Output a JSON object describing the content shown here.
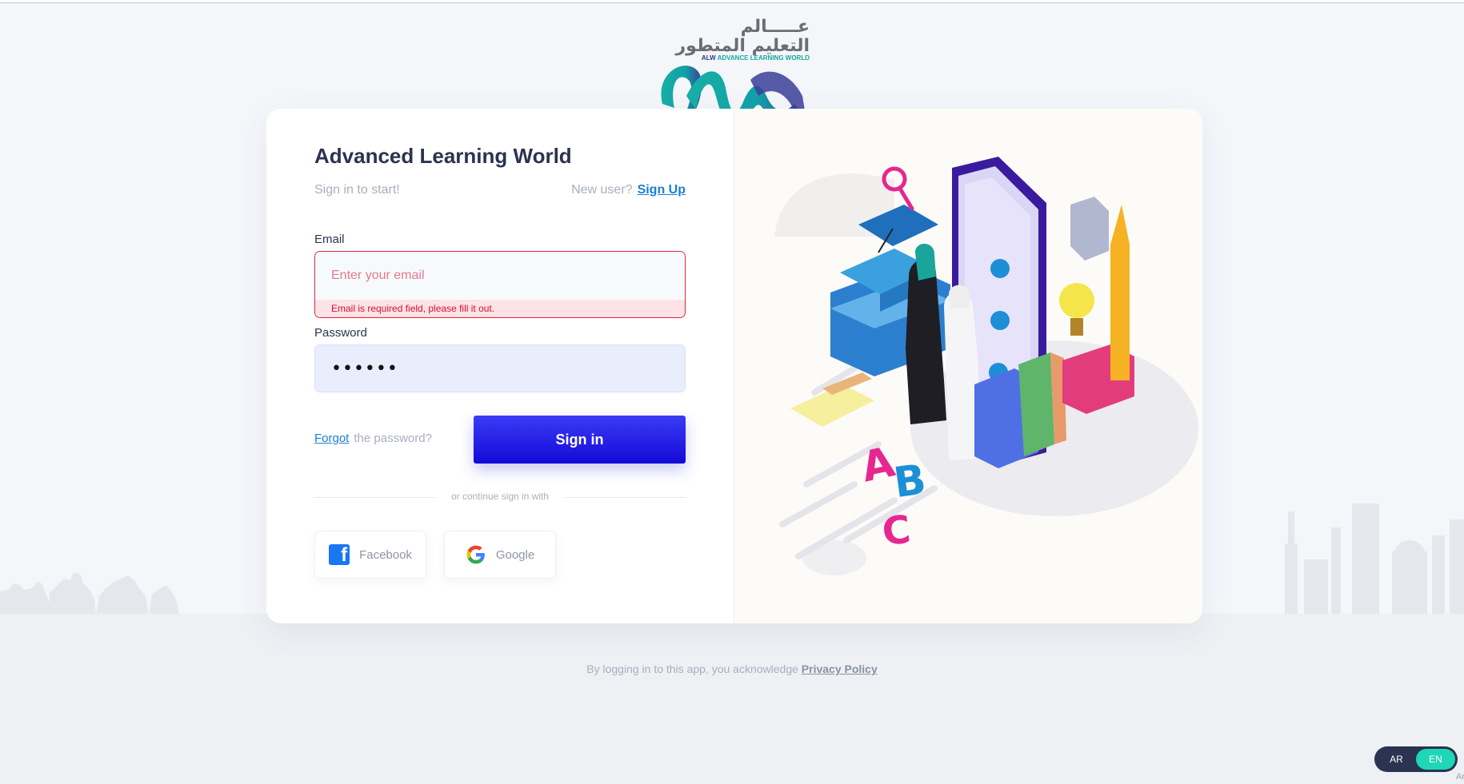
{
  "app": {
    "title": "Advanced Learning World",
    "logo": {
      "arabic_line1": "عـــــالم",
      "arabic_line2": "التعليم المتطور",
      "english_prefix": "ALW",
      "english_name": "ADVANCE LEARNING WORLD",
      "colors": {
        "teal": "#14a8a0",
        "navy": "#2d3a88"
      }
    }
  },
  "login": {
    "subtitle": "Sign in to start!",
    "new_user_text": "New user?",
    "sign_up_label": "Sign Up",
    "email": {
      "label": "Email",
      "value": "",
      "placeholder": "Enter your email",
      "error": "Email is required field, please fill it out."
    },
    "password": {
      "label": "Password",
      "masked_value": "••••••"
    },
    "forgot_link": "Forgot",
    "forgot_suffix": "the password?",
    "submit_label": "Sign in",
    "divider_text": "or continue sign in with",
    "social": [
      {
        "label": "Facebook",
        "icon": "facebook-icon"
      },
      {
        "label": "Google",
        "icon": "google-icon"
      }
    ]
  },
  "footer": {
    "text": "By logging in to this app, you acknowledge",
    "link": "Privacy Policy"
  },
  "language": {
    "options": [
      "AR",
      "EN"
    ],
    "selected": "EN"
  },
  "corner_text": "Ar",
  "colors": {
    "primary": "#1309d8",
    "error": "#e0243f",
    "link": "#1a7fd4",
    "accent": "#1fd6b6"
  }
}
